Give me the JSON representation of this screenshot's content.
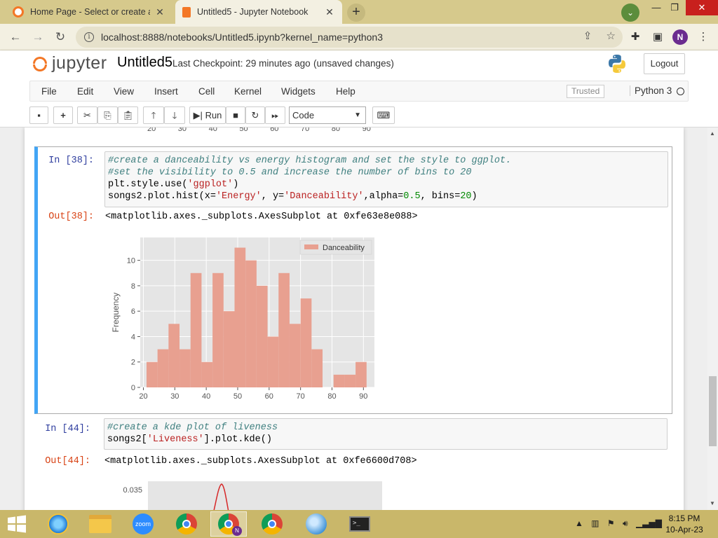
{
  "browser": {
    "tabs": [
      {
        "title": "Home Page - Select or create a n",
        "active": false
      },
      {
        "title": "Untitled5 - Jupyter Notebook",
        "active": true
      }
    ],
    "new_tab": "+",
    "url": "localhost:8888/notebooks/Untitled5.ipynb?kernel_name=python3",
    "profile_initial": "N"
  },
  "jupyter": {
    "logo_text": "jupyter",
    "notebook_name": "Untitled5",
    "checkpoint": "Last Checkpoint: 29 minutes ago",
    "save_status": "(unsaved changes)",
    "logout": "Logout",
    "menus": [
      "File",
      "Edit",
      "View",
      "Insert",
      "Cell",
      "Kernel",
      "Widgets",
      "Help"
    ],
    "trusted": "Trusted",
    "kernel": "Python 3",
    "run_label": "Run",
    "cell_type": "Code"
  },
  "notebook": {
    "previous_ticks": [
      "20",
      "30",
      "40",
      "50",
      "60",
      "70",
      "80",
      "90"
    ],
    "cell_38": {
      "in_prompt": "In [38]:",
      "out_prompt": "Out[38]:",
      "code": [
        "#create a danceability vs energy histogram and set the style to ggplot.",
        "#set the visibility to 0.5 and increase the number of bins to 20",
        "plt.style.use('ggplot')",
        "songs2.plot.hist(x='Energy', y='Danceability',alpha=0.5, bins=20)"
      ],
      "output": "<matplotlib.axes._subplots.AxesSubplot at 0xfe63e8e088>"
    },
    "cell_44": {
      "in_prompt": "In [44]:",
      "out_prompt": "Out[44]:",
      "code": [
        "#create a kde plot of liveness",
        "songs2['Liveness'].plot.kde()"
      ],
      "output": "<matplotlib.axes._subplots.AxesSubplot at 0xfe6600d708>",
      "visible_tick": "0.035"
    }
  },
  "chart_data": {
    "type": "bar",
    "style": "ggplot histogram",
    "ylabel": "Frequency",
    "xlabel": "",
    "legend": [
      "Danceability"
    ],
    "legend_position": "top-right",
    "color": "#e8a090",
    "xlim": [
      19,
      93.5
    ],
    "ylim": [
      0,
      11.8
    ],
    "xticks": [
      20,
      30,
      40,
      50,
      60,
      70,
      80,
      90
    ],
    "yticks": [
      0,
      2,
      4,
      6,
      8,
      10
    ],
    "bins": [
      {
        "x0": 21.0,
        "x1": 24.5,
        "count": 2
      },
      {
        "x0": 24.5,
        "x1": 28.0,
        "count": 3
      },
      {
        "x0": 28.0,
        "x1": 31.5,
        "count": 5
      },
      {
        "x0": 31.5,
        "x1": 35.0,
        "count": 3
      },
      {
        "x0": 35.0,
        "x1": 38.5,
        "count": 9
      },
      {
        "x0": 38.5,
        "x1": 42.0,
        "count": 2
      },
      {
        "x0": 42.0,
        "x1": 45.5,
        "count": 9
      },
      {
        "x0": 45.5,
        "x1": 49.0,
        "count": 6
      },
      {
        "x0": 49.0,
        "x1": 52.5,
        "count": 11
      },
      {
        "x0": 52.5,
        "x1": 56.0,
        "count": 10
      },
      {
        "x0": 56.0,
        "x1": 59.5,
        "count": 8
      },
      {
        "x0": 59.5,
        "x1": 63.0,
        "count": 4
      },
      {
        "x0": 63.0,
        "x1": 66.5,
        "count": 9
      },
      {
        "x0": 66.5,
        "x1": 70.0,
        "count": 5
      },
      {
        "x0": 70.0,
        "x1": 73.5,
        "count": 7
      },
      {
        "x0": 73.5,
        "x1": 77.0,
        "count": 3
      },
      {
        "x0": 77.0,
        "x1": 80.5,
        "count": 0
      },
      {
        "x0": 80.5,
        "x1": 84.0,
        "count": 1
      },
      {
        "x0": 84.0,
        "x1": 87.5,
        "count": 1
      },
      {
        "x0": 87.5,
        "x1": 91.0,
        "count": 2
      }
    ]
  },
  "taskbar": {
    "apps": [
      "start",
      "ie",
      "file-explorer",
      "zoom",
      "chrome",
      "chrome-profile",
      "chrome-alt",
      "app-circle",
      "terminal"
    ],
    "zoom_label": "zoom",
    "time": "8:15 PM",
    "date": "10-Apr-23"
  },
  "colors": {
    "accent_blue": "#42a5f5",
    "in_prompt": "#303f9f",
    "out_prompt": "#d84315",
    "bar_fill": "#e8a090",
    "plot_bg": "#e5e5e5"
  }
}
